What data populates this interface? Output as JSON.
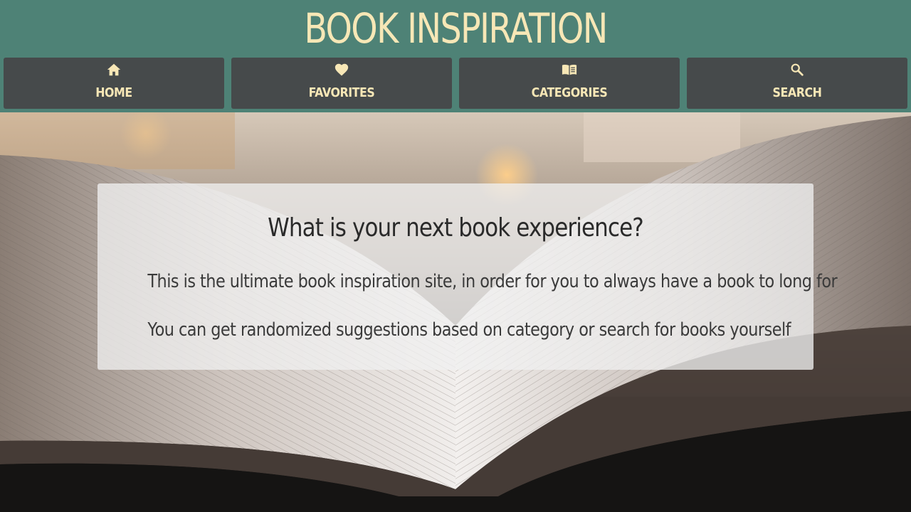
{
  "header": {
    "title": "BOOK INSPIRATION",
    "background_color": "#4e8276",
    "title_color": "#f7e7b6"
  },
  "nav": {
    "button_color": "#464a4b",
    "items": [
      {
        "label": "HOME",
        "icon": "home-icon"
      },
      {
        "label": "FAVORITES",
        "icon": "heart-icon"
      },
      {
        "label": "CATEGORIES",
        "icon": "open-book-icon"
      },
      {
        "label": "SEARCH",
        "icon": "search-icon"
      }
    ]
  },
  "hero": {
    "background_image": "open-book-photo",
    "heading": "What is your next book experience?",
    "lines": [
      "This is the ultimate book inspiration site, in order for you to always have a book to long for",
      "You can get randomized suggestions based on category or search for books yourself"
    ]
  }
}
